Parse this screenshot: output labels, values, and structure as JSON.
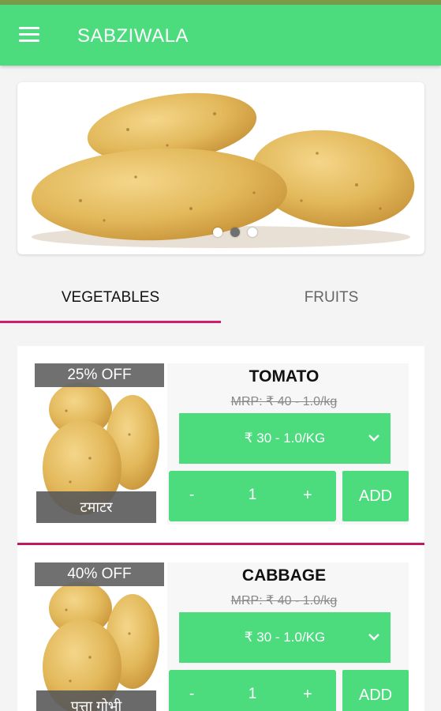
{
  "app": {
    "title": "SABZIWALA"
  },
  "banner": {
    "image": "potatoes-photo",
    "slide_count": 3,
    "active_slide": 2
  },
  "tabs": [
    {
      "label": "VEGETABLES",
      "active": true
    },
    {
      "label": "FRUITS",
      "active": false
    }
  ],
  "products": [
    {
      "name": "TOMATO",
      "local_name": "टमाटर",
      "discount": "25% OFF",
      "mrp": "MRP: ₹ 40 - 1.0/kg",
      "price_option": "₹ 30 - 1.0/KG",
      "quantity": "1",
      "minus": "-",
      "plus": "+",
      "add_label": "ADD"
    },
    {
      "name": "CABBAGE",
      "local_name": "पत्ता गोभी",
      "discount": "40% OFF",
      "mrp": "MRP: ₹ 40 - 1.0/kg",
      "price_option": "₹ 30 - 1.0/KG",
      "quantity": "1",
      "minus": "-",
      "plus": "+",
      "add_label": "ADD"
    }
  ],
  "colors": {
    "appbar": "#4cdc7e",
    "accent": "#d01e6e",
    "button": "#4cdc7e"
  }
}
